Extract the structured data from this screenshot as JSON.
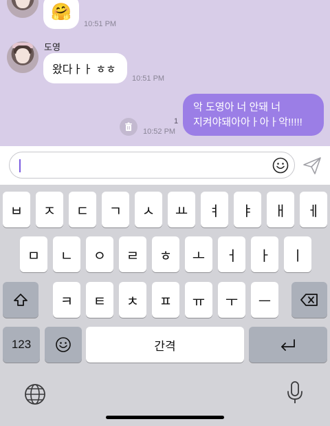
{
  "messages": {
    "first": {
      "emoji": "🤗",
      "time": "10:51 PM"
    },
    "second": {
      "sender": "도영",
      "text": "왔다ㅏㅏ ㅎㅎ",
      "time": "10:51 PM"
    },
    "third": {
      "text_line1": "악 도영아 너 안돼 너",
      "text_line2": "지켜야돼아아ㅏ아ㅏ악!!!!!",
      "unread_count": "1",
      "time": "10:52 PM"
    }
  },
  "input": {
    "value": ""
  },
  "keyboard": {
    "row1": [
      "ㅂ",
      "ㅈ",
      "ㄷ",
      "ㄱ",
      "ㅅ",
      "ㅛ",
      "ㅕ",
      "ㅑ",
      "ㅐ",
      "ㅔ"
    ],
    "row2": [
      "ㅁ",
      "ㄴ",
      "ㅇ",
      "ㄹ",
      "ㅎ",
      "ㅗ",
      "ㅓ",
      "ㅏ",
      "ㅣ"
    ],
    "row3": [
      "ㅋ",
      "ㅌ",
      "ㅊ",
      "ㅍ",
      "ㅠ",
      "ㅜ",
      "ㅡ"
    ],
    "numbers_label": "123",
    "space_label": "간격"
  },
  "colors": {
    "chat_bg": "#d8cde8",
    "outgoing_bubble": "#9b7ee6",
    "caret": "#7b5ce0"
  }
}
